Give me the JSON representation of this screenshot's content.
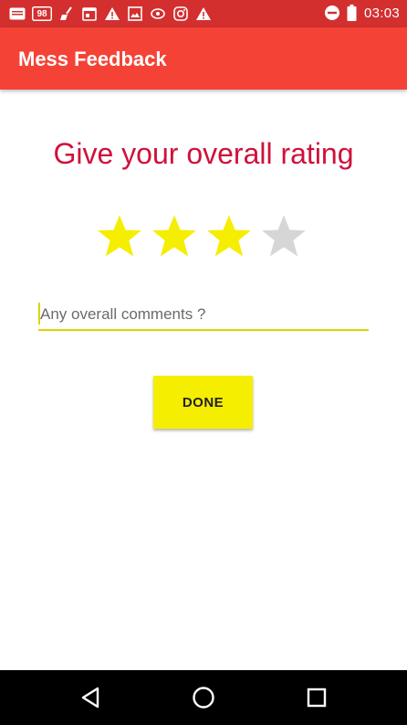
{
  "status_bar": {
    "time": "03:03",
    "left_icons": [
      "message-icon",
      "badge-98-icon",
      "broom-icon",
      "calendar-icon",
      "warning-icon",
      "image-icon",
      "sync-icon",
      "instagram-icon",
      "warning-icon"
    ],
    "badge_text": "98",
    "right_icons": [
      "do-not-disturb-icon",
      "battery-icon"
    ],
    "color": "#d32f2f"
  },
  "app_bar": {
    "title": "Mess Feedback",
    "color": "#f44336"
  },
  "rating_section": {
    "heading": "Give your overall rating",
    "rating": 3,
    "max_rating": 4,
    "filled_color": "#f5ee00",
    "empty_color": "#d6d6d6",
    "heading_color": "#d0103a"
  },
  "comment": {
    "value": "",
    "placeholder": "Any overall comments ?"
  },
  "done_button": {
    "label": "DONE",
    "color": "#f5ee00"
  },
  "nav_bar": {
    "icons": [
      "back-icon",
      "home-icon",
      "recents-icon"
    ]
  }
}
